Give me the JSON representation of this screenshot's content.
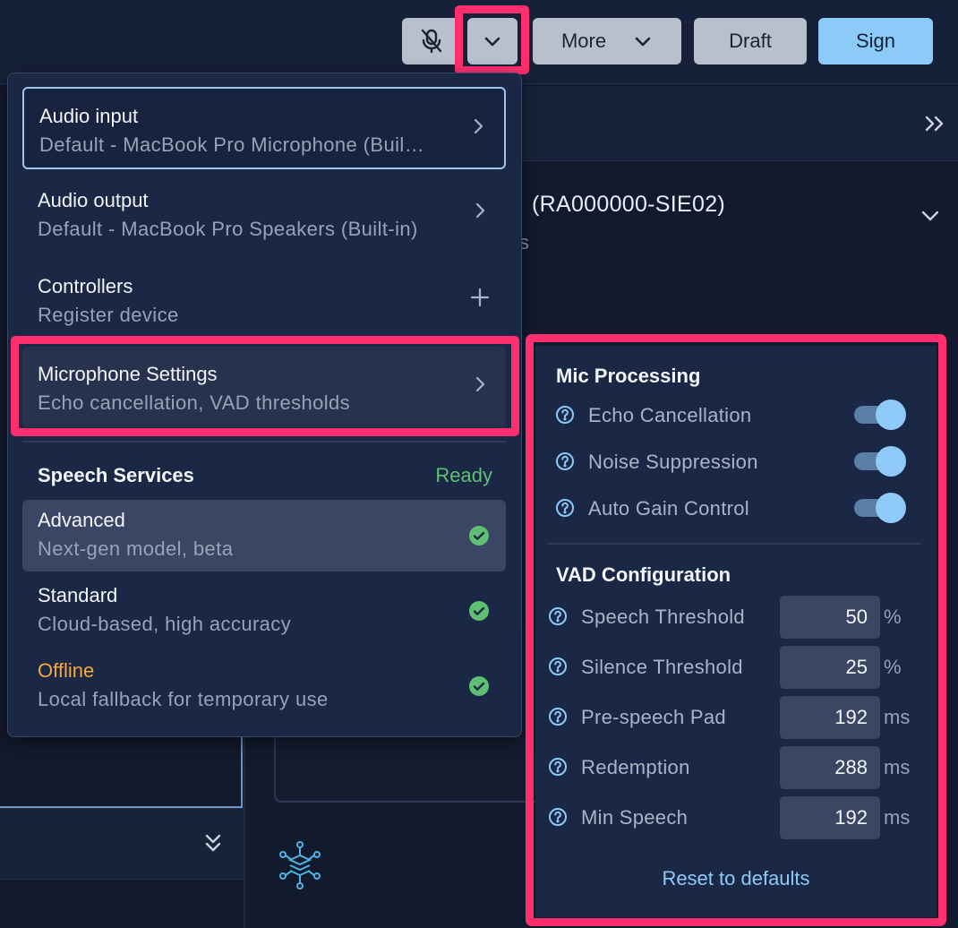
{
  "toolbar": {
    "mic_button": "mic-muted",
    "more_label": "More",
    "draft_label": "Draft",
    "sign_label": "Sign"
  },
  "background": {
    "record_title": "(RA000000-SIE02)",
    "record_sub": "s"
  },
  "audio_menu": {
    "items": [
      {
        "title": "Audio input",
        "subtitle": "Default - MacBook Pro Microphone (Buil…",
        "icon": "chevron-right-icon"
      },
      {
        "title": "Audio output",
        "subtitle": "Default - MacBook Pro Speakers (Built-in)",
        "icon": "chevron-right-icon"
      },
      {
        "title": "Controllers",
        "subtitle": "Register device",
        "icon": "plus-icon"
      },
      {
        "title": "Microphone Settings",
        "subtitle": "Echo cancellation, VAD thresholds",
        "icon": "chevron-right-icon"
      }
    ],
    "speech_services": {
      "heading": "Speech Services",
      "status": "Ready",
      "options": [
        {
          "title": "Advanced",
          "subtitle": "Next-gen model, beta",
          "selected": true
        },
        {
          "title": "Standard",
          "subtitle": "Cloud-based, high accuracy",
          "selected": false
        },
        {
          "title": "Offline",
          "subtitle": "Local fallback for temporary use",
          "selected": false
        }
      ]
    }
  },
  "mic_settings": {
    "processing_heading": "Mic Processing",
    "toggles": [
      {
        "label": "Echo Cancellation",
        "on": true
      },
      {
        "label": "Noise Suppression",
        "on": true
      },
      {
        "label": "Auto Gain Control",
        "on": true
      }
    ],
    "vad_heading": "VAD Configuration",
    "vad": [
      {
        "label": "Speech Threshold",
        "value": "50",
        "unit": "%"
      },
      {
        "label": "Silence Threshold",
        "value": "25",
        "unit": "%"
      },
      {
        "label": "Pre-speech Pad",
        "value": "192",
        "unit": "ms"
      },
      {
        "label": "Redemption",
        "value": "288",
        "unit": "ms"
      },
      {
        "label": "Min Speech",
        "value": "192",
        "unit": "ms"
      }
    ],
    "reset_label": "Reset to defaults"
  },
  "colors": {
    "accent": "#8ccbf8",
    "highlight": "#ff2e6f",
    "ready": "#5fbf72",
    "offline": "#f4a93b"
  }
}
